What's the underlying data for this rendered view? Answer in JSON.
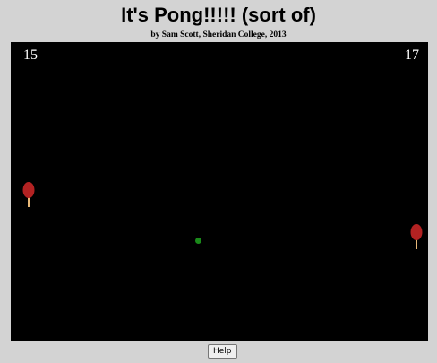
{
  "header": {
    "title": "It's Pong!!!!! (sort of)",
    "byline": "by Sam Scott, Sheridan College, 2013"
  },
  "game": {
    "score_left": "15",
    "score_right": "17",
    "colors": {
      "court": "#000000",
      "paddle_head": "#b22222",
      "paddle_handle": "#e8b878",
      "ball": "#1a8a1a",
      "score_text": "#ffffff"
    },
    "icons": {
      "left_paddle": "ping-pong-paddle-icon",
      "right_paddle": "ping-pong-paddle-icon",
      "ball": "ball-icon"
    }
  },
  "controls": {
    "help_label": "Help"
  }
}
